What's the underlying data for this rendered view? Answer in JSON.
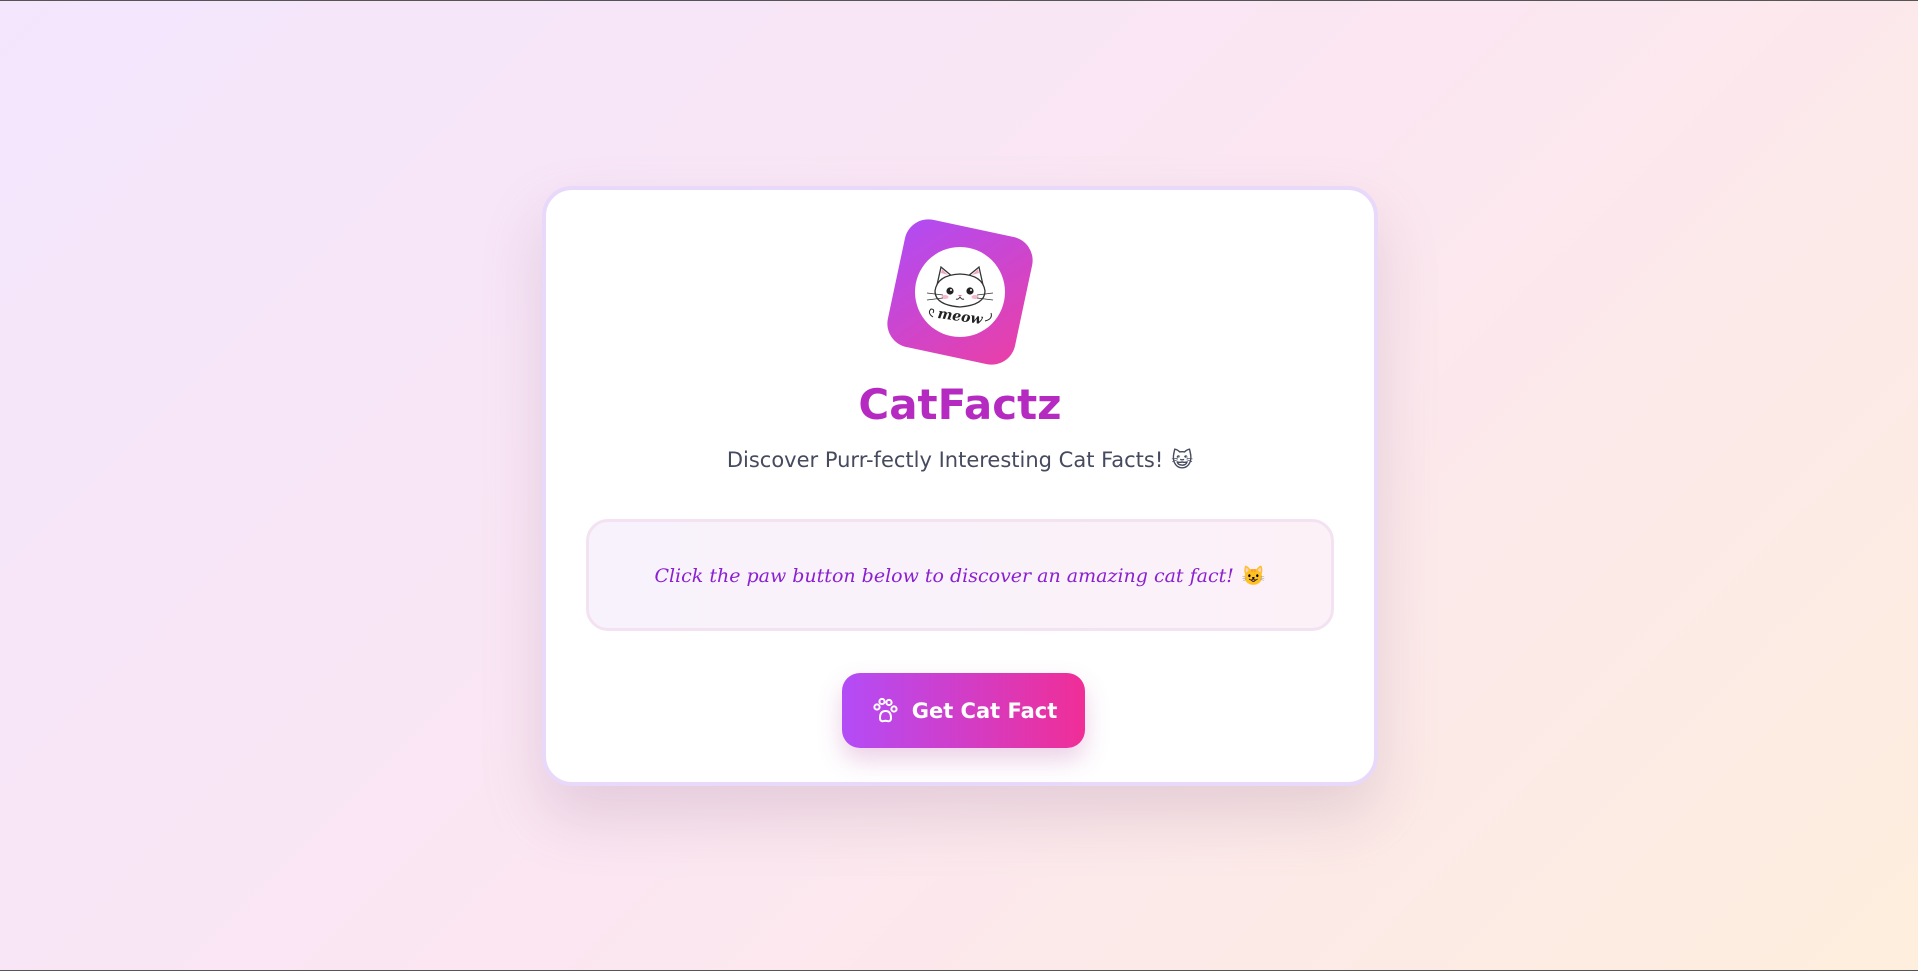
{
  "app": {
    "title": "CatFactz",
    "subtitle": "Discover Purr-fectly Interesting Cat Facts!",
    "subtitle_emoji": "😺"
  },
  "logo": {
    "text": "meow",
    "icon": "cat-face-icon"
  },
  "fact_box": {
    "text": "Click the paw button below to discover an amazing cat fact!",
    "emoji": "😺"
  },
  "button": {
    "label": "Get Cat Fact",
    "icon": "paw-icon"
  },
  "colors": {
    "accent_purple": "#b04cf5",
    "accent_pink": "#ea3fa6",
    "title": "#b52ac0",
    "fact_text": "#8a20d0"
  }
}
